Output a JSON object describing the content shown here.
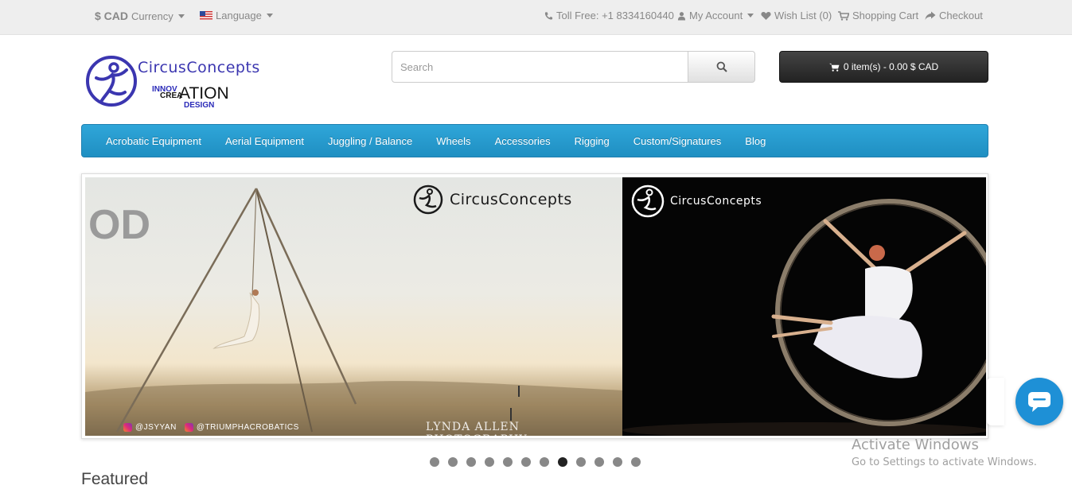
{
  "topbar": {
    "currency_symbol": "$ CAD",
    "currency_label": "Currency",
    "language_label": "Language",
    "toll_free": "Toll Free: +1 8334160440",
    "my_account": "My Account",
    "wish_list": "Wish List (0)",
    "shopping_cart": "Shopping Cart",
    "checkout": "Checkout"
  },
  "header": {
    "logo_word": "CircusConcepts",
    "logo_innov": "INNOV",
    "logo_crea": "CREA",
    "logo_ation": "ATION",
    "logo_design": "DESIGN",
    "search_placeholder": "Search",
    "cart_label": "0 item(s) - 0.00 $ CAD"
  },
  "nav": {
    "items": [
      {
        "label": "Acrobatic Equipment"
      },
      {
        "label": "Aerial Equipment"
      },
      {
        "label": "Juggling / Balance"
      },
      {
        "label": "Wheels"
      },
      {
        "label": "Accessories"
      },
      {
        "label": "Rigging"
      },
      {
        "label": "Custom/Signatures"
      },
      {
        "label": "Blog"
      }
    ]
  },
  "slideshow": {
    "left_big_text": "OD",
    "left_watermark": "CircusConcepts",
    "right_watermark": "CircusConcepts",
    "insta_1": "@JSYYAN",
    "insta_2": "@TRIUMPHACROBATICS",
    "photo_credit": "LYNDA ALLEN PHOTOGRAPHY",
    "dot_count": 12,
    "active_dot": 8
  },
  "featured_heading": "Featured",
  "overlay": {
    "activate_title": "Activate Windows",
    "activate_sub": "Go to Settings to activate Windows."
  },
  "colors": {
    "nav_blue": "#2fa6d9",
    "logo_purple": "#3b36b0",
    "chat_blue": "#1e90d6"
  }
}
